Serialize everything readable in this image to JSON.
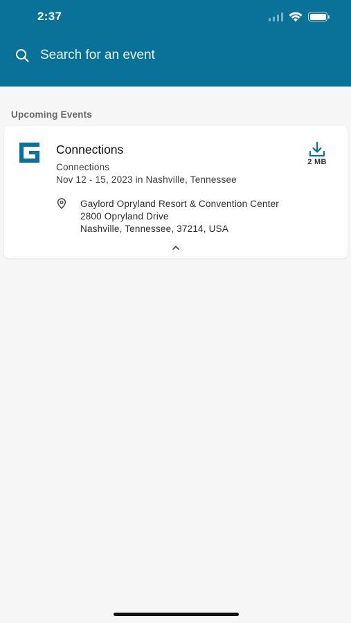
{
  "status_bar": {
    "time": "2:37",
    "icons": [
      "cellular-signal-icon",
      "wifi-icon",
      "battery-icon"
    ]
  },
  "search": {
    "placeholder": "Search for an event",
    "value": ""
  },
  "section": {
    "label": "Upcoming Events"
  },
  "events": [
    {
      "logo_icon": "guidebook-logo-icon",
      "title": "Connections",
      "subtitle": "Connections",
      "dates": "Nov 12 - 15, 2023 in Nashville, Tennessee",
      "download_size": "2 MB",
      "address_lines": [
        "Gaylord Opryland Resort & Convention Center",
        "2800 Opryland Drive",
        "Nashville, Tennessee, 37214, USA"
      ]
    }
  ],
  "colors": {
    "header_bg": "#0a7199",
    "accent": "#0a7199",
    "page_bg": "#f6f6f6",
    "card_bg": "#ffffff"
  }
}
